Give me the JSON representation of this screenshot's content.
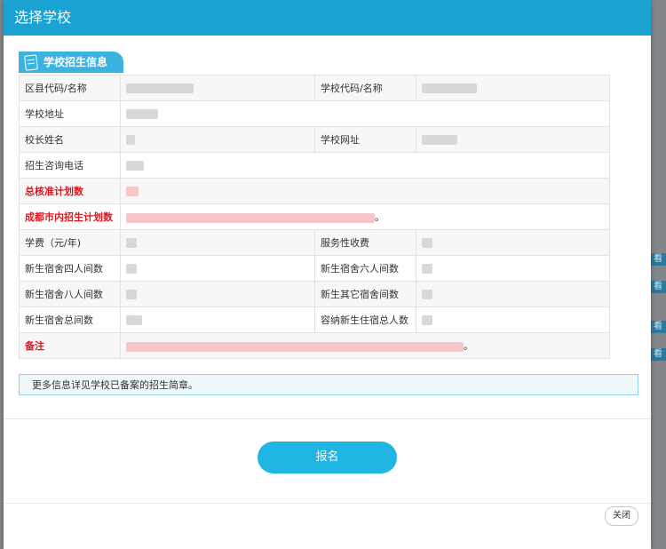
{
  "dialog": {
    "title": "选择学校",
    "section_label": "学校招生信息",
    "notice": "更多信息详见学校已备案的招生简章。",
    "apply_label": "报名",
    "close_label": "关闭"
  },
  "table": {
    "rows": [
      {
        "l1": "区县代码/名称",
        "l2": "学校代码/名称"
      },
      {
        "l1": "学校地址"
      },
      {
        "l1": "校长姓名",
        "l2": "学校网址"
      },
      {
        "l1": "招生咨询电话"
      },
      {
        "l1": "总核准计划数"
      },
      {
        "l1": "成都市内招生计划数",
        "v1_tail": "。"
      },
      {
        "l1": "学费（元/年)",
        "l2": "服务性收费"
      },
      {
        "l1": "新生宿舍四人间数",
        "l2": "新生宿舍六人间数"
      },
      {
        "l1": "新生宿舍八人间数",
        "l2": "新生其它宿舍间数"
      },
      {
        "l1": "新生宿舍总间数",
        "l2": "容纳新生住宿总人数"
      },
      {
        "l1": "备注",
        "v1_tail": "。"
      }
    ]
  },
  "background": {
    "tag_label": "看"
  },
  "colors": {
    "header": "#1aa3d2",
    "accent": "#1fb6e3",
    "warning_label": "#e0161e"
  }
}
